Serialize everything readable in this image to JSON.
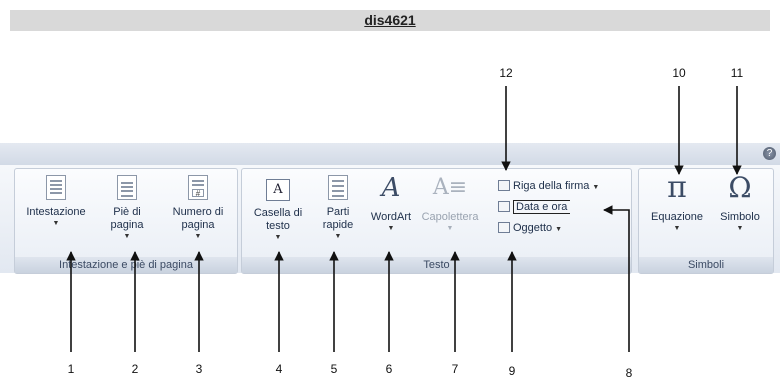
{
  "header": {
    "title": "dis4621"
  },
  "ribbon": {
    "help_glyph": "?",
    "groups": [
      {
        "label": "Intestazione e piè di pagina",
        "buttons": [
          {
            "label": "Intestazione",
            "icon": "header-page-icon"
          },
          {
            "label": "Piè di pagina",
            "icon": "footer-page-icon"
          },
          {
            "label": "Numero di pagina",
            "icon": "page-number-icon"
          }
        ]
      },
      {
        "label": "Testo",
        "buttons": [
          {
            "label": "Casella di testo",
            "icon": "text-box-icon"
          },
          {
            "label": "Parti rapide",
            "icon": "quick-parts-icon"
          },
          {
            "label": "WordArt",
            "icon": "wordart-icon"
          },
          {
            "label": "Capolettera",
            "icon": "drop-cap-icon",
            "enabled": false
          }
        ],
        "side_items": [
          {
            "label": "Riga della firma",
            "icon": "signature-line-icon"
          },
          {
            "label": "Data e ora",
            "icon": "date-time-icon"
          },
          {
            "label": "Oggetto",
            "icon": "object-icon"
          }
        ]
      },
      {
        "label": "Simboli",
        "buttons": [
          {
            "label": "Equazione",
            "icon": "pi-icon",
            "glyph": "π"
          },
          {
            "label": "Simbolo",
            "icon": "omega-icon",
            "glyph": "Ω"
          }
        ]
      }
    ]
  },
  "callouts": {
    "bottom": [
      "1",
      "2",
      "3",
      "4",
      "5",
      "6",
      "7",
      "9",
      "8"
    ],
    "top": [
      "12",
      "10",
      "11"
    ]
  }
}
